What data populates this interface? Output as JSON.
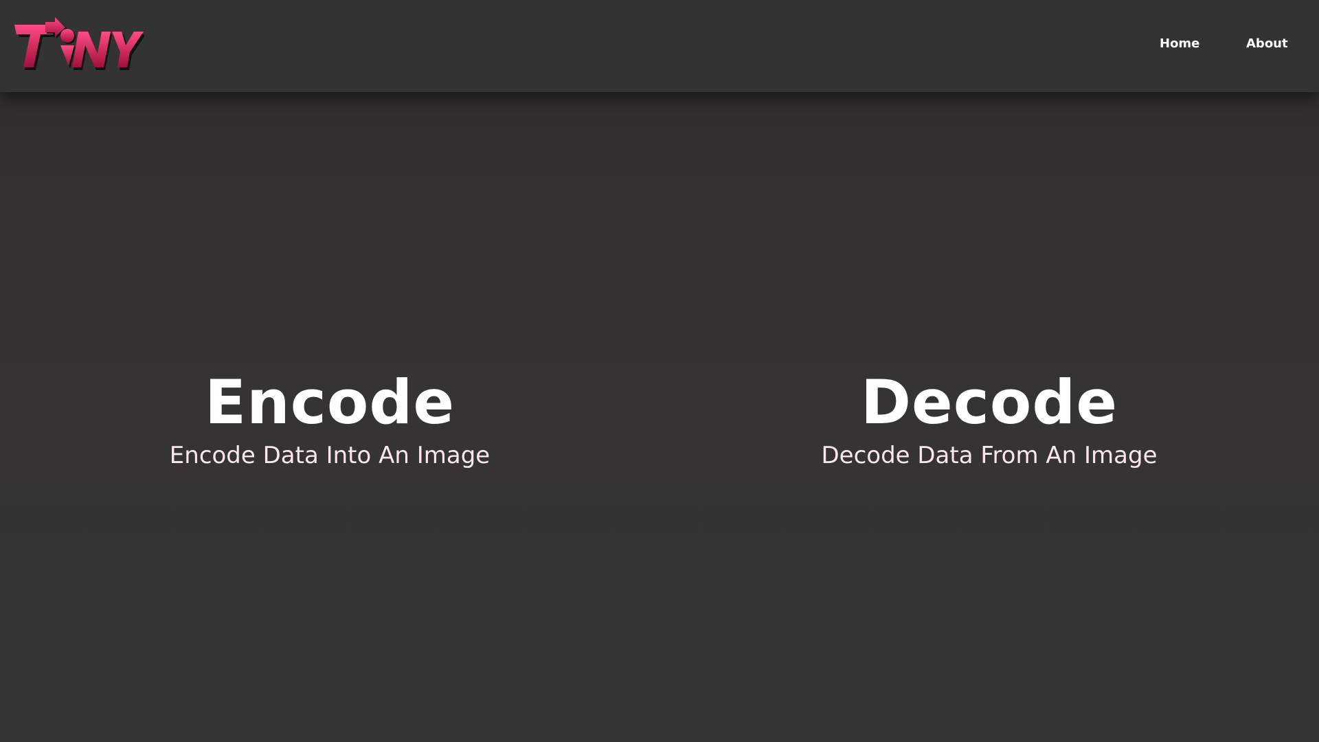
{
  "header": {
    "logo_text": "TiNY",
    "brand_color": "#e0245e",
    "nav": {
      "home_label": "Home",
      "about_label": "About"
    }
  },
  "main": {
    "encode": {
      "title": "Encode",
      "subtitle": "Encode Data Into An Image"
    },
    "decode": {
      "title": "Decode",
      "subtitle": "Decode Data From An Image"
    }
  },
  "colors": {
    "navbar_bg": "#333333",
    "page_bg": "#343233",
    "title_text": "#ffffff",
    "subtitle_text": "#fde7ee"
  }
}
